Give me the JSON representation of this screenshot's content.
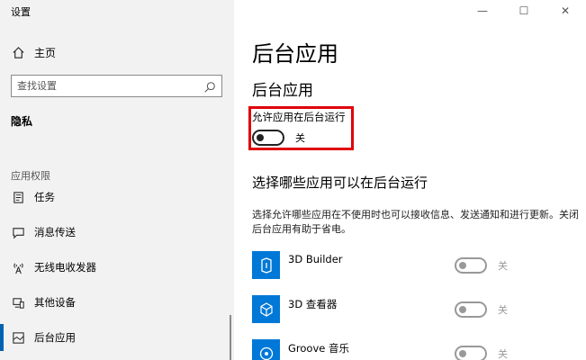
{
  "window": {
    "title": "设置",
    "controls": [
      "—",
      "☐",
      "✕"
    ]
  },
  "sidebar": {
    "home": {
      "label": "主页",
      "icon": "home-icon"
    },
    "search": {
      "placeholder": "查找设置",
      "icon": "search-icon"
    },
    "section_heading": "隐私",
    "group_label": "应用权限",
    "items": [
      {
        "label": "任务",
        "icon": "task-icon",
        "selected": false
      },
      {
        "label": "消息传送",
        "icon": "message-icon",
        "selected": false
      },
      {
        "label": "无线电收发器",
        "icon": "radio-icon",
        "selected": false
      },
      {
        "label": "其他设备",
        "icon": "devices-icon",
        "selected": false
      },
      {
        "label": "后台应用",
        "icon": "background-apps-icon",
        "selected": true
      }
    ]
  },
  "main": {
    "page_title": "后台应用",
    "section_title": "后台应用",
    "allow_label": "允许应用在后台运行",
    "allow_toggle": {
      "state": "off",
      "text": "关"
    },
    "choose_title": "选择哪些应用可以在后台运行",
    "description": "选择允许哪些应用在不使用时也可以接收信息、发送通知和进行更新。关闭后台应用有助于省电。",
    "apps": [
      {
        "name": "3D Builder",
        "toggle_text": "关",
        "icon": "3d-builder-icon",
        "color": "#0078d7"
      },
      {
        "name": "3D 查看器",
        "toggle_text": "关",
        "icon": "3d-viewer-icon",
        "color": "#0078d7"
      },
      {
        "name": "Groove 音乐",
        "toggle_text": "关",
        "icon": "groove-music-icon",
        "color": "#0078d7"
      }
    ]
  },
  "colors": {
    "accent": "#0063b1",
    "highlight": "#e0000a",
    "app_tile": "#0078d7",
    "sidebar_bg": "#f2f2f2"
  }
}
